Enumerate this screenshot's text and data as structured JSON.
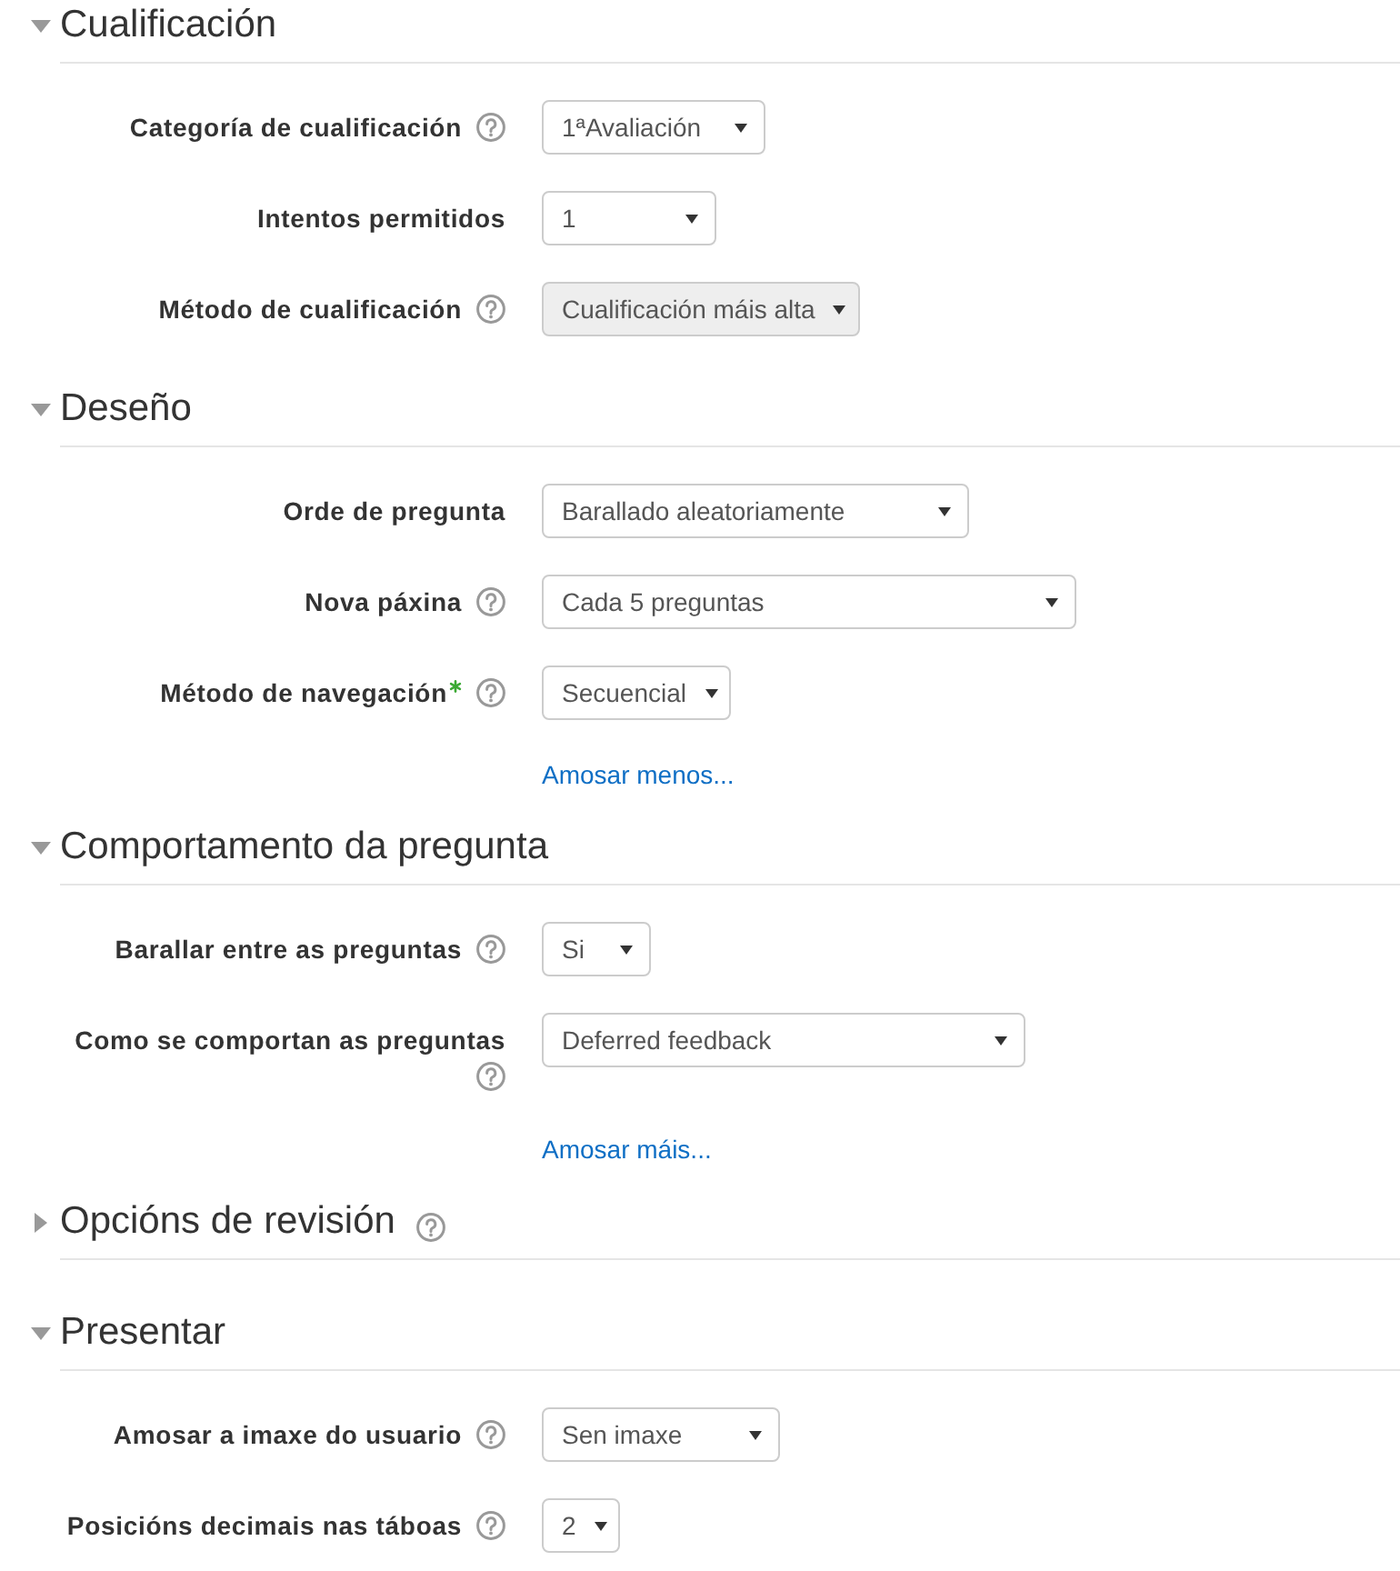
{
  "sections": [
    {
      "title": "Cualificación",
      "expanded": true,
      "help": false,
      "fields": [
        {
          "label": "Categoría de cualificación",
          "required": false,
          "help": true,
          "value": "1ªAvaliación",
          "disabled": false
        },
        {
          "label": "Intentos permitidos",
          "required": false,
          "help": false,
          "value": "1",
          "disabled": false
        },
        {
          "label": "Método de cualificación",
          "required": false,
          "help": true,
          "value": "Cualificación máis alta",
          "disabled": true
        }
      ]
    },
    {
      "title": "Deseño",
      "expanded": true,
      "help": false,
      "fields": [
        {
          "label": "Orde de pregunta",
          "required": false,
          "help": false,
          "value": "Barallado aleatoriamente",
          "disabled": false
        },
        {
          "label": "Nova páxina",
          "required": false,
          "help": true,
          "value": "Cada 5 preguntas",
          "disabled": false
        },
        {
          "label": "Método de navegación",
          "required": true,
          "help": true,
          "value": "Secuencial",
          "disabled": false
        }
      ],
      "link": "Amosar menos..."
    },
    {
      "title": "Comportamento da pregunta",
      "expanded": true,
      "help": false,
      "fields": [
        {
          "label": "Barallar entre as preguntas",
          "required": false,
          "help": true,
          "value": "Si",
          "disabled": false
        },
        {
          "label": "Como se comportan as preguntas",
          "required": false,
          "help": true,
          "value": "Deferred feedback",
          "disabled": false
        }
      ],
      "link": "Amosar máis..."
    },
    {
      "title": "Opcións de revisión",
      "expanded": false,
      "help": true
    },
    {
      "title": "Presentar",
      "expanded": true,
      "help": false,
      "fields": [
        {
          "label": "Amosar a imaxe do usuario",
          "required": false,
          "help": true,
          "value": "Sen imaxe",
          "disabled": false
        },
        {
          "label": "Posicións decimais nas táboas",
          "required": false,
          "help": true,
          "value": "2",
          "disabled": false
        }
      ]
    }
  ]
}
